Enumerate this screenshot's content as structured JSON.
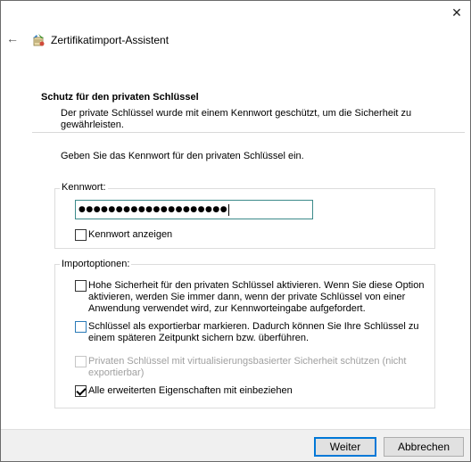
{
  "window": {
    "close_glyph": "✕",
    "back_glyph": "←",
    "title": "Zertifikatimport-Assistent"
  },
  "section": {
    "heading": "Schutz für den privaten Schlüssel",
    "description": "Der private Schlüssel wurde mit einem Kennwort geschützt, um die Sicherheit zu gewährleisten."
  },
  "instruction": "Geben Sie das Kennwort für den privaten Schlüssel ein.",
  "password_group": {
    "legend": "Kennwort:",
    "masked_value": "●●●●●●●●●●●●●●●●●●●●",
    "show_password_label": "Kennwort anzeigen",
    "show_password_checked": false
  },
  "import_options": {
    "legend": "Importoptionen:",
    "options": [
      {
        "label": "Hohe Sicherheit für den privaten Schlüssel aktivieren. Wenn Sie diese Option aktivieren, werden Sie immer dann, wenn der private Schlüssel von einer Anwendung verwendet wird, zur Kennworteingabe aufgefordert.",
        "checked": false,
        "enabled": true
      },
      {
        "label": "Schlüssel als exportierbar markieren. Dadurch können Sie Ihre Schlüssel zu einem späteren Zeitpunkt sichern bzw. überführen.",
        "checked": false,
        "enabled": true
      },
      {
        "label": "Privaten Schlüssel mit virtualisierungsbasierter Sicherheit schützen (nicht exportierbar)",
        "checked": false,
        "enabled": false
      },
      {
        "label": "Alle erweiterten Eigenschaften mit einbeziehen",
        "checked": true,
        "enabled": true
      }
    ]
  },
  "buttons": {
    "next": "Weiter",
    "cancel": "Abbrechen"
  },
  "colors": {
    "focus_border": "#3c8a8a",
    "primary_button_border": "#0078d7",
    "disabled_text": "#a0a0a0"
  }
}
